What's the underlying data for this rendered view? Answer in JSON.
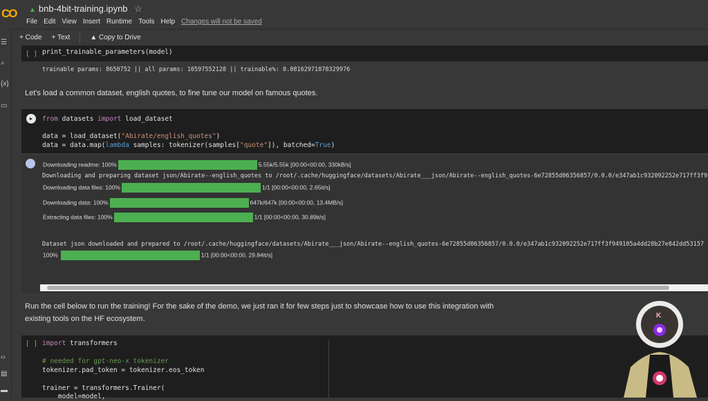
{
  "header": {
    "logo": "CO",
    "title": "bnb-4bit-training.ipynb",
    "menu": [
      "File",
      "Edit",
      "View",
      "Insert",
      "Runtime",
      "Tools",
      "Help"
    ],
    "unsaved": "Changes will not be saved"
  },
  "toolbar": {
    "code": "+ Code",
    "text": "+ Text",
    "copy": "Copy to Drive"
  },
  "cell1": {
    "bracket": "[ ]",
    "code": "print_trainable_parameters(model)",
    "output": "trainable params: 8650752 || all params: 10597552128 || trainable%: 0.08162971878329976"
  },
  "text1": "Let's load a common dataset, english quotes, to fine tune our model on famous quotes.",
  "cell2": {
    "l1a": "from",
    "l1b": " datasets ",
    "l1c": "import",
    "l1d": " load_dataset",
    "l2a": "data = load_dataset(",
    "l2b": "\"Abirate/english_quotes\"",
    "l2c": ")",
    "l3a": "data = data.map(",
    "l3b": "lambda",
    "l3c": " samples: tokenizer(samples[",
    "l3d": "\"quote\"",
    "l3e": "]), batched=",
    "l3f": "True",
    "l3g": ")"
  },
  "output2": {
    "p1": {
      "label": "Downloading readme: 100%",
      "stat": "5.55k/5.55k [00:00<00:00, 330kB/s]",
      "progress": 100
    },
    "prep": "Downloading and preparing dataset json/Abirate--english_quotes to /root/.cache/huggingface/datasets/Abirate___json/Abirate--english_quotes-6e72855d06356857/0.0.0/e347ab1c932092252e717ff3f9",
    "p2": {
      "label": "Downloading data files: 100%",
      "stat": "1/1 [00:00<00:00, 2.65it/s]",
      "progress": 100
    },
    "p3": {
      "label": "Downloading data: 100%",
      "stat": "647k/647k [00:00<00:00, 13.4MB/s]",
      "progress": 100
    },
    "p4": {
      "label": "Extracting data files: 100%",
      "stat": "1/1 [00:00<00:00, 30.89it/s]",
      "progress": 100
    },
    "done": "Dataset json downloaded and prepared to /root/.cache/huggingface/datasets/Abirate___json/Abirate--english_quotes-6e72855d06356857/0.0.0/e347ab1c932092252e717ff3f949105a4dd28b27e842dd53157",
    "p5": {
      "label": "100%",
      "stat": "1/1 [00:00<00:00, 29.84it/s]",
      "progress": 100
    }
  },
  "text2": {
    "l1": "Run the cell below to run the training! For the sake of the demo, we just ran it for few steps just to showcase how to use this integration with",
    "l2": "existing tools on the HF ecosystem."
  },
  "cell3": {
    "bracket": "[ ]",
    "l1a": "import",
    "l1b": " transformers",
    "l2": "# needed for gpt-neo-x tokenizer",
    "l3": "tokenizer.pad_token = tokenizer.eos_token",
    "l4": "trainer = transformers.Trainer(",
    "l5": "    model=model,"
  },
  "avatar": {
    "letter": "K"
  }
}
